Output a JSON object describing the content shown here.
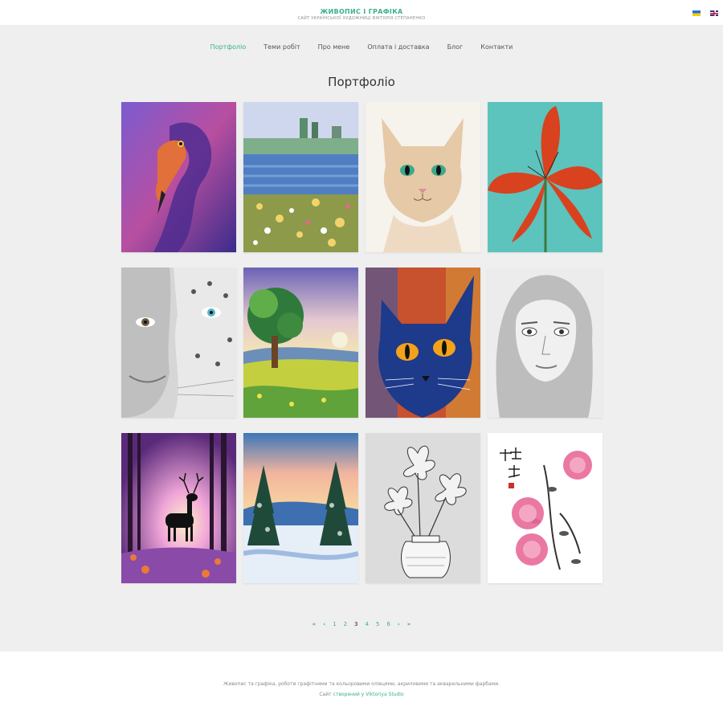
{
  "site": {
    "title": "ЖИВОПИС І ГРАФІКА",
    "subtitle": "САЙТ УКРАЇНСЬКОЇ ХУДОЖНИЦІ ВІКТОРІЯ СТЕПАНЕНКО",
    "languages": [
      {
        "code": "uk",
        "icon": "ukraine-flag-icon",
        "colors": [
          "#2d6fd6",
          "#f4d00c"
        ]
      },
      {
        "code": "en",
        "icon": "uk-flag-icon",
        "colors": [
          "#1f3c8f",
          "#cf142b",
          "#ffffff"
        ]
      }
    ]
  },
  "nav": {
    "items": [
      {
        "label": "Портфоліо",
        "active": true
      },
      {
        "label": "Теми робіт",
        "active": false
      },
      {
        "label": "Про мене",
        "active": false
      },
      {
        "label": "Оплата і доставка",
        "active": false
      },
      {
        "label": "Блог",
        "active": false
      },
      {
        "label": "Контакти",
        "active": false
      }
    ]
  },
  "page": {
    "title": "Портфоліо"
  },
  "gallery": {
    "items": [
      {
        "subject": "flamingo",
        "colors": [
          "#5a3aa0",
          "#e2703a"
        ]
      },
      {
        "subject": "lake-flowers",
        "colors": [
          "#4f7fc2",
          "#e8c05a"
        ]
      },
      {
        "subject": "cat-pencil",
        "colors": [
          "#f3ece4",
          "#3fa88c"
        ]
      },
      {
        "subject": "red-lily",
        "colors": [
          "#5cc3bd",
          "#d8421f"
        ]
      },
      {
        "subject": "woman-leopard",
        "colors": [
          "#d9d9d9",
          "#3a3a3a"
        ]
      },
      {
        "subject": "tree-landscape",
        "colors": [
          "#6a63b5",
          "#c4cf3f"
        ]
      },
      {
        "subject": "blue-cat",
        "colors": [
          "#1e3a8a",
          "#f3a21a"
        ]
      },
      {
        "subject": "girl-portrait",
        "colors": [
          "#e6e6e6",
          "#4a4a4a"
        ]
      },
      {
        "subject": "deer-forest",
        "colors": [
          "#7a3c93",
          "#f0c0e0"
        ]
      },
      {
        "subject": "winter-forest",
        "colors": [
          "#3d76b8",
          "#f2b59e"
        ]
      },
      {
        "subject": "flowers-vase",
        "colors": [
          "#dcdcdc",
          "#3c3c3c"
        ]
      },
      {
        "subject": "peony",
        "colors": [
          "#ffffff",
          "#e86a9a"
        ]
      }
    ]
  },
  "pagination": {
    "first": "«",
    "prev": "‹",
    "pages": [
      "1",
      "2",
      "3",
      "4",
      "5",
      "6"
    ],
    "current": "3",
    "next": "›",
    "last": "»"
  },
  "footer": {
    "text": "Живопис та графіка, роботи графітними та кольоровими олівцями, акриловими та акварельними фарбами.",
    "credit_prefix": "Сайт ",
    "credit_link": "створений у Viktoriya Studio"
  },
  "colors": {
    "accent": "#3bb08f",
    "background": "#efefef"
  }
}
